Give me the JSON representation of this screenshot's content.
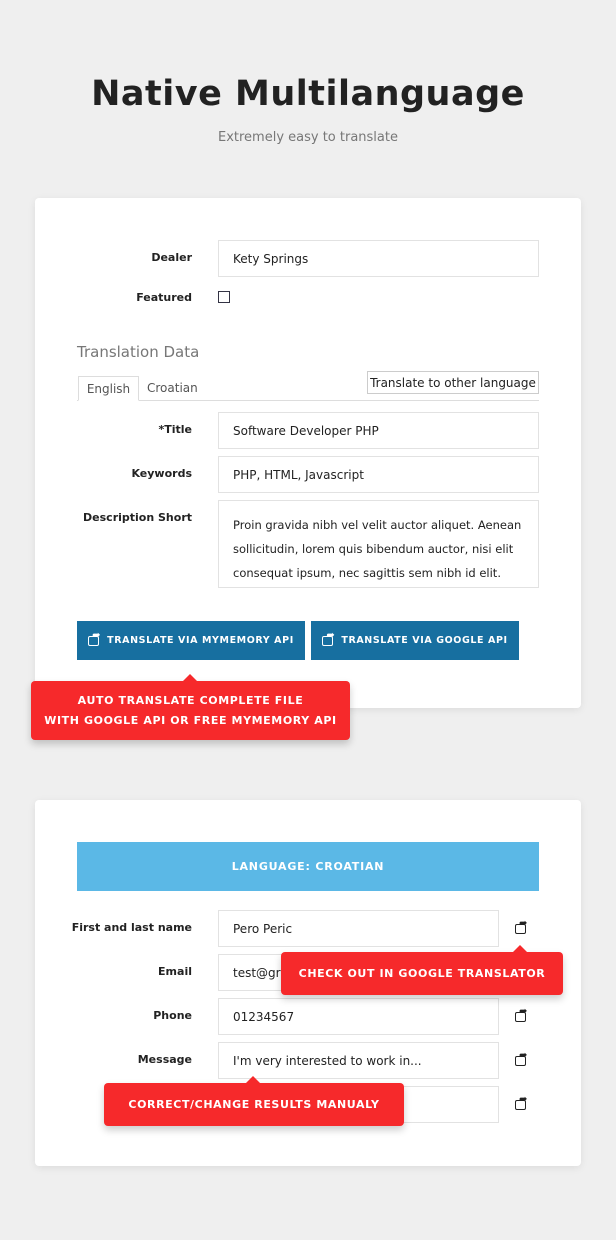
{
  "header": {
    "title": "Native Multilanguage",
    "subtitle": "Extremely easy to translate"
  },
  "form1": {
    "dealer_label": "Dealer",
    "dealer_value": "Kety Springs",
    "featured_label": "Featured",
    "featured_checked": false,
    "section_title": "Translation Data",
    "tabs": [
      {
        "label": "English",
        "active": true
      },
      {
        "label": "Croatian",
        "active": false
      }
    ],
    "translate_other_label": "Translate to other language",
    "fields": [
      {
        "label": "*Title",
        "value": "Software Developer PHP"
      },
      {
        "label": "Keywords",
        "value": "PHP, HTML, Javascript"
      },
      {
        "label": "Description Short",
        "value": "Proin gravida nibh vel velit auctor aliquet. Aenean sollicitudin, lorem quis bibendum auctor, nisi elit consequat ipsum, nec sagittis sem nibh id elit."
      }
    ],
    "buttons": {
      "mymemory": "TRANSLATE VIA MYMEMORY API",
      "google": "TRANSLATE VIA GOOGLE API",
      "icon": "share-square-icon",
      "color": "#176fa0"
    },
    "callout": {
      "line1": "AUTO TRANSLATE COMPLETE FILE",
      "line2": "WITH GOOGLE API OR FREE MYMEMORY API",
      "color": "#f6292b"
    }
  },
  "form2": {
    "language_bar": "LANGUAGE: CROATIAN",
    "language_bar_color": "#5bb8e6",
    "fields": [
      {
        "label": "First and last name",
        "value": "Pero Peric"
      },
      {
        "label": "Email",
        "value": "test@gr"
      },
      {
        "label": "Phone",
        "value": "01234567"
      },
      {
        "label": "Message",
        "value": "I'm very interested to work in..."
      },
      {
        "label": "",
        "value": ""
      }
    ],
    "callout_google": "CHECK OUT IN GOOGLE TRANSLATOR",
    "callout_manual": "CORRECT/CHANGE RESULTS MANUALY"
  }
}
